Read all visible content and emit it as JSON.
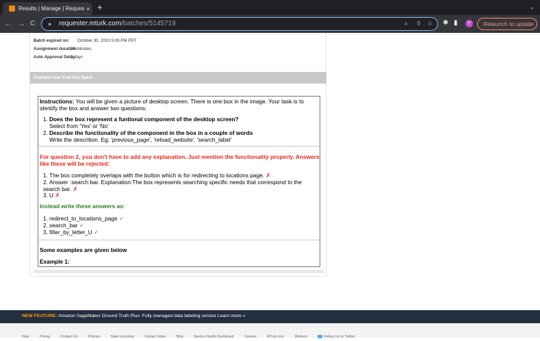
{
  "browser": {
    "tab_title": "Results | Manage | Requester |",
    "tab_close": "×",
    "new_tab": "+",
    "tab_menu": "⌄",
    "nav_back": "←",
    "nav_forward": "→",
    "nav_reload": "C",
    "url_host": "requester.mturk.com",
    "url_path": "/batches/5145719",
    "avatar_letter": "Y",
    "relaunch_label": "Relaunch to update",
    "relaunch_menu": "⋮"
  },
  "batch_meta": [
    {
      "label": "Batch expired on:",
      "value": "October 30, 2023 5:09 PM PDT"
    },
    {
      "label": "Assignment duration:",
      "value": "20 minutes"
    },
    {
      "label": "Auto Approval Delay:",
      "value": "3 days"
    }
  ],
  "section_title": "Example task from this Batch",
  "task": {
    "instructions_label": "Instructions:",
    "instructions_text": " You will be given a picture of desktop screen. There is one box in the image. Your task is to identify the box and answer two questions:",
    "questions": [
      {
        "num": "1.",
        "q": "Does the box represent a funtional component of the desktop screen?",
        "sub": "Select from 'Yes' or 'No'"
      },
      {
        "num": "2.",
        "q": "Describe the functionality of the component in the box in a couple of words",
        "sub": "Write the descrition. Eg: 'previous_page', 'reload_website', 'search_label'"
      }
    ],
    "warning": "For question 2, you don't have to add any explanation. Just mention the functionality properly. Answers like these will be rejected:",
    "rejected": [
      {
        "num": "1.",
        "text": "The box completely overlaps with the button which is for redirecting to locations page.",
        "mark": "✗"
      },
      {
        "num": "2.",
        "text": "Answer :search bar. Explanation:The box represents searching specific needs that correspond to the search bar.",
        "mark": "✗"
      },
      {
        "num": "3.",
        "text": "U",
        "mark": "✗"
      }
    ],
    "instead_label": "Instead write these answers as:",
    "accepted": [
      {
        "num": "1.",
        "text": "redirect_to_locations_page",
        "mark": "✓"
      },
      {
        "num": "2.",
        "text": "search_bar",
        "mark": "✓"
      },
      {
        "num": "3.",
        "text": "filter_by_letter_U",
        "mark": "✓"
      }
    ],
    "examples_heading": "Some examples are given below",
    "example1_heading": "Example 1:"
  },
  "footer": {
    "new_feature_label": "NEW FEATURE:",
    "new_feature_text": " Amazon SageMaker Ground Truth Plus: Fully managed data labeling service  Learn more »",
    "links": [
      "Help",
      "Pricing",
      "Contact Us",
      "Policies",
      "State Licensing",
      "Contact Sales",
      "Blog",
      "Service Health Dashboard",
      "Careers",
      "MTurk.com",
      "Workers"
    ],
    "twitter": "Follow Us on Twitter"
  },
  "colors": {
    "accent_red": "#e6271b",
    "accent_green": "#2f7d1e",
    "feature_orange": "#ff9900",
    "footer_dark": "#232f3e"
  }
}
